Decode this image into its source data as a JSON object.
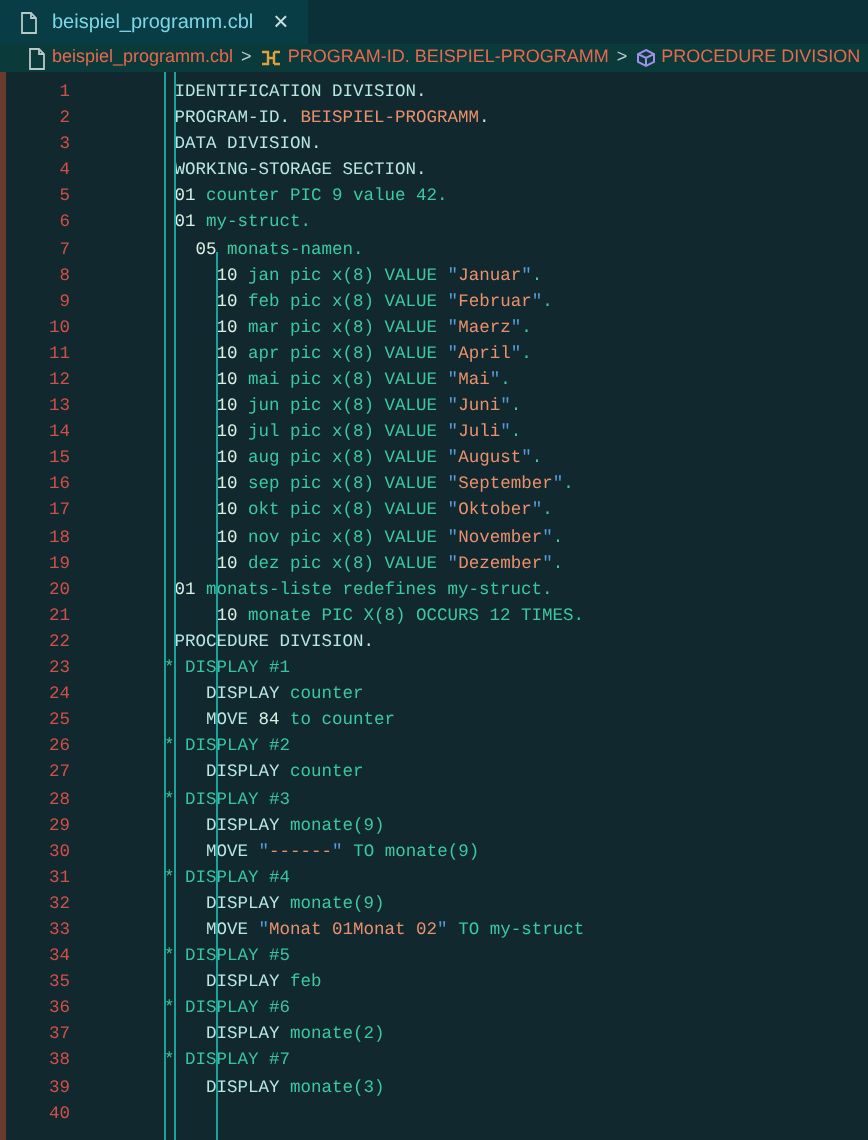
{
  "tabs": [
    {
      "label": "beispiel_programm.cbl",
      "selected": true,
      "close": "×"
    }
  ],
  "breadcrumbs": [
    {
      "kind": "file",
      "label": "beispiel_programm.cbl"
    },
    {
      "kind": "program",
      "label": "PROGRAM-ID. BEISPIEL-PROGRAMM"
    },
    {
      "kind": "division",
      "label": "PROCEDURE DIVISION"
    }
  ],
  "breadcrumb_separator": ">",
  "code_lines": [
    {
      "number": "1",
      "tokens": [
        {
          "text": " IDENTIFICATION DIVISION.",
          "kind": "keyword"
        }
      ]
    },
    {
      "number": "2",
      "tokens": [
        {
          "text": " PROGRAM-ID.",
          "kind": "keyword"
        },
        {
          "text": " BEISPIEL-PROGRAMM",
          "kind": "name"
        },
        {
          "text": ".",
          "kind": "keyword"
        }
      ]
    },
    {
      "number": "3",
      "tokens": [
        {
          "text": " DATA DIVISION.",
          "kind": "keyword"
        }
      ]
    },
    {
      "number": "4",
      "tokens": [
        {
          "text": " WORKING-STORAGE SECTION.",
          "kind": "keyword"
        }
      ]
    },
    {
      "number": "5",
      "tokens": [
        {
          "text": " 01",
          "kind": "number"
        },
        {
          "text": " counter PIC 9 value 42.",
          "kind": "ident"
        }
      ]
    },
    {
      "number": "6",
      "tokens": [
        {
          "text": " 01",
          "kind": "number"
        },
        {
          "text": " my-struct.",
          "kind": "ident"
        }
      ]
    },
    {
      "number": "7",
      "tokens": [
        {
          "text": "   05",
          "kind": "number"
        },
        {
          "text": " monats-namen.",
          "kind": "ident"
        }
      ]
    },
    {
      "number": "8",
      "tokens": [
        {
          "text": "     10",
          "kind": "number"
        },
        {
          "text": " jan pic x(8) VALUE ",
          "kind": "ident"
        },
        {
          "text": "\"",
          "kind": "quote"
        },
        {
          "text": "Januar",
          "kind": "string"
        },
        {
          "text": "\"",
          "kind": "quote"
        },
        {
          "text": ".",
          "kind": "ident"
        }
      ]
    },
    {
      "number": "9",
      "tokens": [
        {
          "text": "     10",
          "kind": "number"
        },
        {
          "text": " feb pic x(8) VALUE ",
          "kind": "ident"
        },
        {
          "text": "\"",
          "kind": "quote"
        },
        {
          "text": "Februar",
          "kind": "string"
        },
        {
          "text": "\"",
          "kind": "quote"
        },
        {
          "text": ".",
          "kind": "ident"
        }
      ]
    },
    {
      "number": "10",
      "tokens": [
        {
          "text": "     10",
          "kind": "number"
        },
        {
          "text": " mar pic x(8) VALUE ",
          "kind": "ident"
        },
        {
          "text": "\"",
          "kind": "quote"
        },
        {
          "text": "Maerz",
          "kind": "string"
        },
        {
          "text": "\"",
          "kind": "quote"
        },
        {
          "text": ".",
          "kind": "ident"
        }
      ]
    },
    {
      "number": "11",
      "tokens": [
        {
          "text": "     10",
          "kind": "number"
        },
        {
          "text": " apr pic x(8) VALUE ",
          "kind": "ident"
        },
        {
          "text": "\"",
          "kind": "quote"
        },
        {
          "text": "April",
          "kind": "string"
        },
        {
          "text": "\"",
          "kind": "quote"
        },
        {
          "text": ".",
          "kind": "ident"
        }
      ]
    },
    {
      "number": "12",
      "tokens": [
        {
          "text": "     10",
          "kind": "number"
        },
        {
          "text": " mai pic x(8) VALUE ",
          "kind": "ident"
        },
        {
          "text": "\"",
          "kind": "quote"
        },
        {
          "text": "Mai",
          "kind": "string"
        },
        {
          "text": "\"",
          "kind": "quote"
        },
        {
          "text": ".",
          "kind": "ident"
        }
      ]
    },
    {
      "number": "13",
      "tokens": [
        {
          "text": "     10",
          "kind": "number"
        },
        {
          "text": " jun pic x(8) VALUE ",
          "kind": "ident"
        },
        {
          "text": "\"",
          "kind": "quote"
        },
        {
          "text": "Juni",
          "kind": "string"
        },
        {
          "text": "\"",
          "kind": "quote"
        },
        {
          "text": ".",
          "kind": "ident"
        }
      ]
    },
    {
      "number": "14",
      "tokens": [
        {
          "text": "     10",
          "kind": "number"
        },
        {
          "text": " jul pic x(8) VALUE ",
          "kind": "ident"
        },
        {
          "text": "\"",
          "kind": "quote"
        },
        {
          "text": "Juli",
          "kind": "string"
        },
        {
          "text": "\"",
          "kind": "quote"
        },
        {
          "text": ".",
          "kind": "ident"
        }
      ]
    },
    {
      "number": "15",
      "tokens": [
        {
          "text": "     10",
          "kind": "number"
        },
        {
          "text": " aug pic x(8) VALUE ",
          "kind": "ident"
        },
        {
          "text": "\"",
          "kind": "quote"
        },
        {
          "text": "August",
          "kind": "string"
        },
        {
          "text": "\"",
          "kind": "quote"
        },
        {
          "text": ".",
          "kind": "ident"
        }
      ]
    },
    {
      "number": "16",
      "tokens": [
        {
          "text": "     10",
          "kind": "number"
        },
        {
          "text": " sep pic x(8) VALUE ",
          "kind": "ident"
        },
        {
          "text": "\"",
          "kind": "quote"
        },
        {
          "text": "September",
          "kind": "string"
        },
        {
          "text": "\"",
          "kind": "quote"
        },
        {
          "text": ".",
          "kind": "ident"
        }
      ]
    },
    {
      "number": "17",
      "tokens": [
        {
          "text": "     10",
          "kind": "number"
        },
        {
          "text": " okt pic x(8) VALUE ",
          "kind": "ident"
        },
        {
          "text": "\"",
          "kind": "quote"
        },
        {
          "text": "Oktober",
          "kind": "string"
        },
        {
          "text": "\"",
          "kind": "quote"
        },
        {
          "text": ".",
          "kind": "ident"
        }
      ]
    },
    {
      "number": "18",
      "tokens": [
        {
          "text": "     10",
          "kind": "number"
        },
        {
          "text": " nov pic x(8) VALUE ",
          "kind": "ident"
        },
        {
          "text": "\"",
          "kind": "quote"
        },
        {
          "text": "November",
          "kind": "string"
        },
        {
          "text": "\"",
          "kind": "quote"
        },
        {
          "text": ".",
          "kind": "ident"
        }
      ]
    },
    {
      "number": "19",
      "tokens": [
        {
          "text": "     10",
          "kind": "number"
        },
        {
          "text": " dez pic x(8) VALUE ",
          "kind": "ident"
        },
        {
          "text": "\"",
          "kind": "quote"
        },
        {
          "text": "Dezember",
          "kind": "string"
        },
        {
          "text": "\"",
          "kind": "quote"
        },
        {
          "text": ".",
          "kind": "ident"
        }
      ]
    },
    {
      "number": "20",
      "tokens": [
        {
          "text": " 01",
          "kind": "number"
        },
        {
          "text": " monats-liste redefines my-struct.",
          "kind": "ident"
        }
      ]
    },
    {
      "number": "21",
      "tokens": [
        {
          "text": "     10",
          "kind": "number"
        },
        {
          "text": " monate PIC X(8) OCCURS 12 TIMES.",
          "kind": "ident"
        }
      ]
    },
    {
      "number": "22",
      "tokens": [
        {
          "text": " PROCEDURE DIVISION.",
          "kind": "keyword"
        }
      ]
    },
    {
      "number": "23",
      "tokens": [
        {
          "text": "* DISPLAY #1",
          "kind": "comment"
        }
      ]
    },
    {
      "number": "24",
      "tokens": [
        {
          "text": "    DISPLAY",
          "kind": "keyword"
        },
        {
          "text": " counter",
          "kind": "ident"
        }
      ]
    },
    {
      "number": "25",
      "tokens": [
        {
          "text": "    MOVE",
          "kind": "keyword"
        },
        {
          "text": " 84",
          "kind": "number"
        },
        {
          "text": " to counter",
          "kind": "ident"
        }
      ]
    },
    {
      "number": "26",
      "tokens": [
        {
          "text": "* DISPLAY #2",
          "kind": "comment"
        }
      ]
    },
    {
      "number": "27",
      "tokens": [
        {
          "text": "    DISPLAY",
          "kind": "keyword"
        },
        {
          "text": " counter",
          "kind": "ident"
        }
      ]
    },
    {
      "number": "28",
      "tokens": [
        {
          "text": "* DISPLAY #3",
          "kind": "comment"
        }
      ]
    },
    {
      "number": "29",
      "tokens": [
        {
          "text": "    DISPLAY",
          "kind": "keyword"
        },
        {
          "text": " monate(9)",
          "kind": "ident"
        }
      ]
    },
    {
      "number": "30",
      "tokens": [
        {
          "text": "    MOVE ",
          "kind": "keyword"
        },
        {
          "text": "\"",
          "kind": "quote"
        },
        {
          "text": "------",
          "kind": "string"
        },
        {
          "text": "\"",
          "kind": "quote"
        },
        {
          "text": " TO monate(9)",
          "kind": "ident"
        }
      ]
    },
    {
      "number": "31",
      "tokens": [
        {
          "text": "* DISPLAY #4",
          "kind": "comment"
        }
      ]
    },
    {
      "number": "32",
      "tokens": [
        {
          "text": "    DISPLAY",
          "kind": "keyword"
        },
        {
          "text": " monate(9)",
          "kind": "ident"
        }
      ]
    },
    {
      "number": "33",
      "tokens": [
        {
          "text": "    MOVE ",
          "kind": "keyword"
        },
        {
          "text": "\"",
          "kind": "quote"
        },
        {
          "text": "Monat 01Monat 02",
          "kind": "string"
        },
        {
          "text": "\"",
          "kind": "quote"
        },
        {
          "text": " TO my-struct",
          "kind": "ident"
        }
      ]
    },
    {
      "number": "34",
      "tokens": [
        {
          "text": "* DISPLAY #5",
          "kind": "comment"
        }
      ]
    },
    {
      "number": "35",
      "tokens": [
        {
          "text": "    DISPLAY",
          "kind": "keyword"
        },
        {
          "text": " feb",
          "kind": "ident"
        }
      ]
    },
    {
      "number": "36",
      "tokens": [
        {
          "text": "* DISPLAY #6",
          "kind": "comment"
        }
      ]
    },
    {
      "number": "37",
      "tokens": [
        {
          "text": "    DISPLAY",
          "kind": "keyword"
        },
        {
          "text": " monate(2)",
          "kind": "ident"
        }
      ]
    },
    {
      "number": "38",
      "tokens": [
        {
          "text": "* DISPLAY #7",
          "kind": "comment"
        }
      ]
    },
    {
      "number": "39",
      "tokens": [
        {
          "text": "    DISPLAY",
          "kind": "keyword"
        },
        {
          "text": " monate(3)",
          "kind": "ident"
        }
      ]
    },
    {
      "number": "40"
    }
  ]
}
